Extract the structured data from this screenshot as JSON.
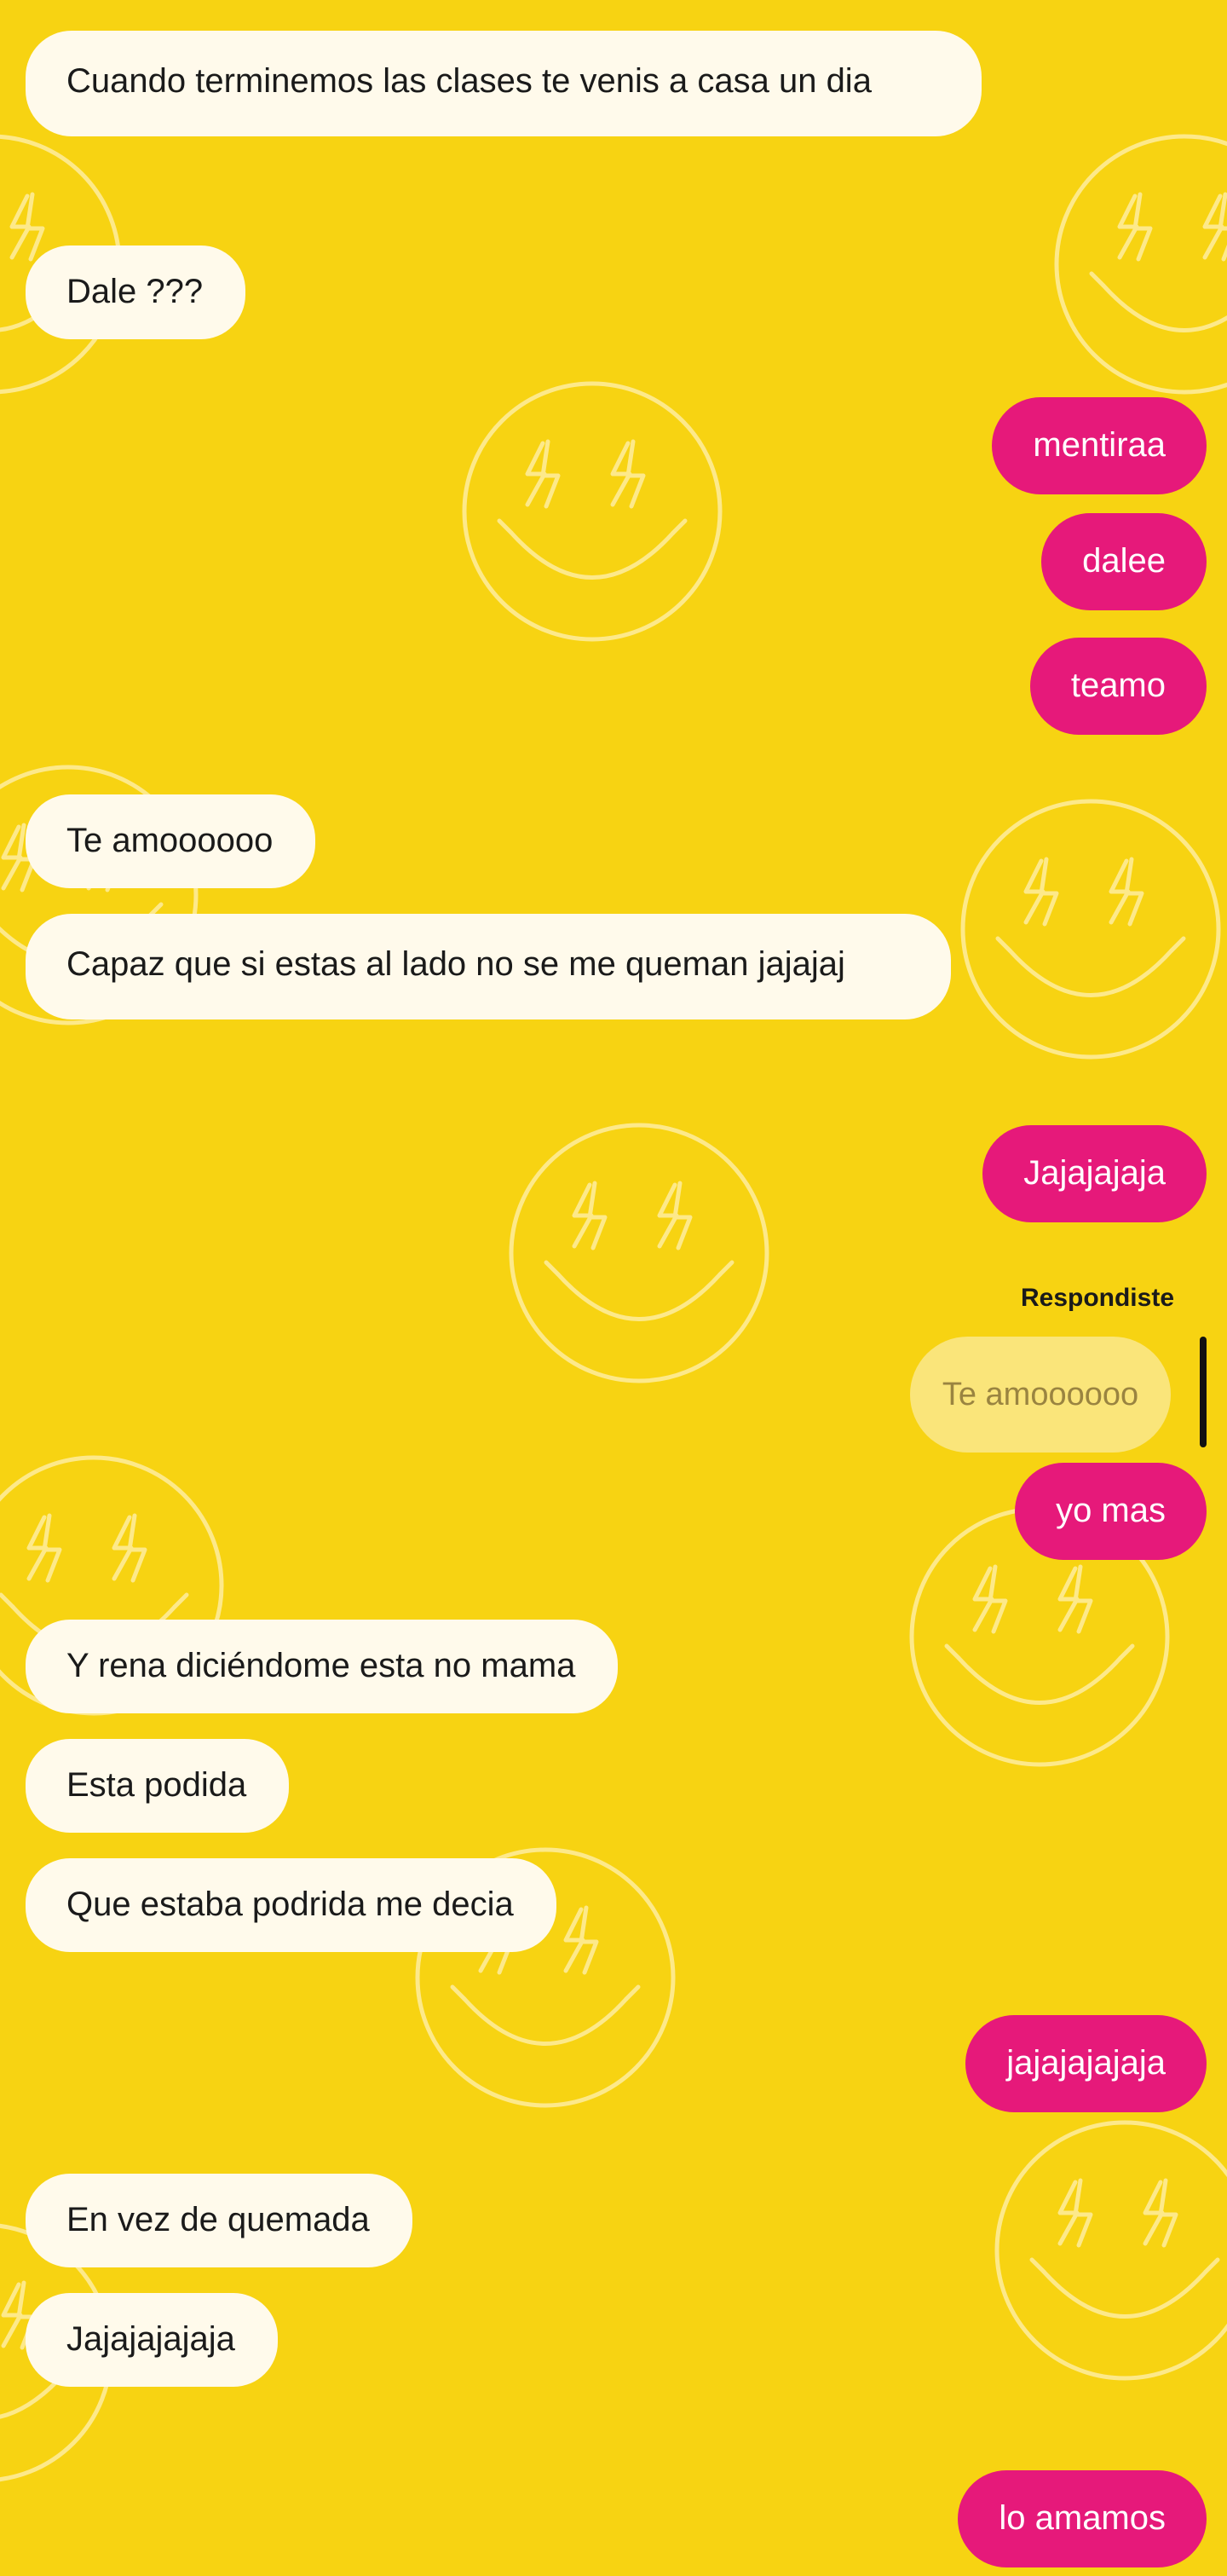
{
  "theme": {
    "background": "#f7d312",
    "incoming_bubble": "#fffaeb",
    "outgoing_bubble": "#e6197a",
    "reply_quote_bubble": "#fae57a",
    "wallpaper_stroke": "#fde98a",
    "wallpaper_icon": "smiley-with-lightning-eyes-icon"
  },
  "messages": [
    {
      "id": "m1",
      "direction": "incoming",
      "text": "Cuando terminemos las clases te venis a casa un dia"
    },
    {
      "id": "m2",
      "direction": "incoming",
      "text": "Dale ???"
    },
    {
      "id": "m3",
      "direction": "outgoing",
      "text": "mentiraa"
    },
    {
      "id": "m4",
      "direction": "outgoing",
      "text": "dalee"
    },
    {
      "id": "m5",
      "direction": "outgoing",
      "text": "teamo"
    },
    {
      "id": "m6",
      "direction": "incoming",
      "text": "Te amoooooo"
    },
    {
      "id": "m7",
      "direction": "incoming",
      "text": "Capaz que si estas al lado no se me queman jajajaj"
    },
    {
      "id": "m8",
      "direction": "outgoing",
      "text": "Jajajajaja"
    },
    {
      "id": "m9",
      "direction": "outgoing",
      "reply_label": "Respondiste",
      "quoted_text": "Te amoooooo",
      "text": "yo mas"
    },
    {
      "id": "m10",
      "direction": "incoming",
      "text": "Y rena diciéndome esta no mama"
    },
    {
      "id": "m11",
      "direction": "incoming",
      "text": "Esta podida"
    },
    {
      "id": "m12",
      "direction": "incoming",
      "text": "Que estaba podrida me decia"
    },
    {
      "id": "m13",
      "direction": "outgoing",
      "text": "jajajajajaja"
    },
    {
      "id": "m14",
      "direction": "incoming",
      "text": "En vez de quemada"
    },
    {
      "id": "m15",
      "direction": "incoming",
      "text": "Jajajajajaja"
    },
    {
      "id": "m16",
      "direction": "outgoing",
      "text": "lo amamos"
    }
  ]
}
